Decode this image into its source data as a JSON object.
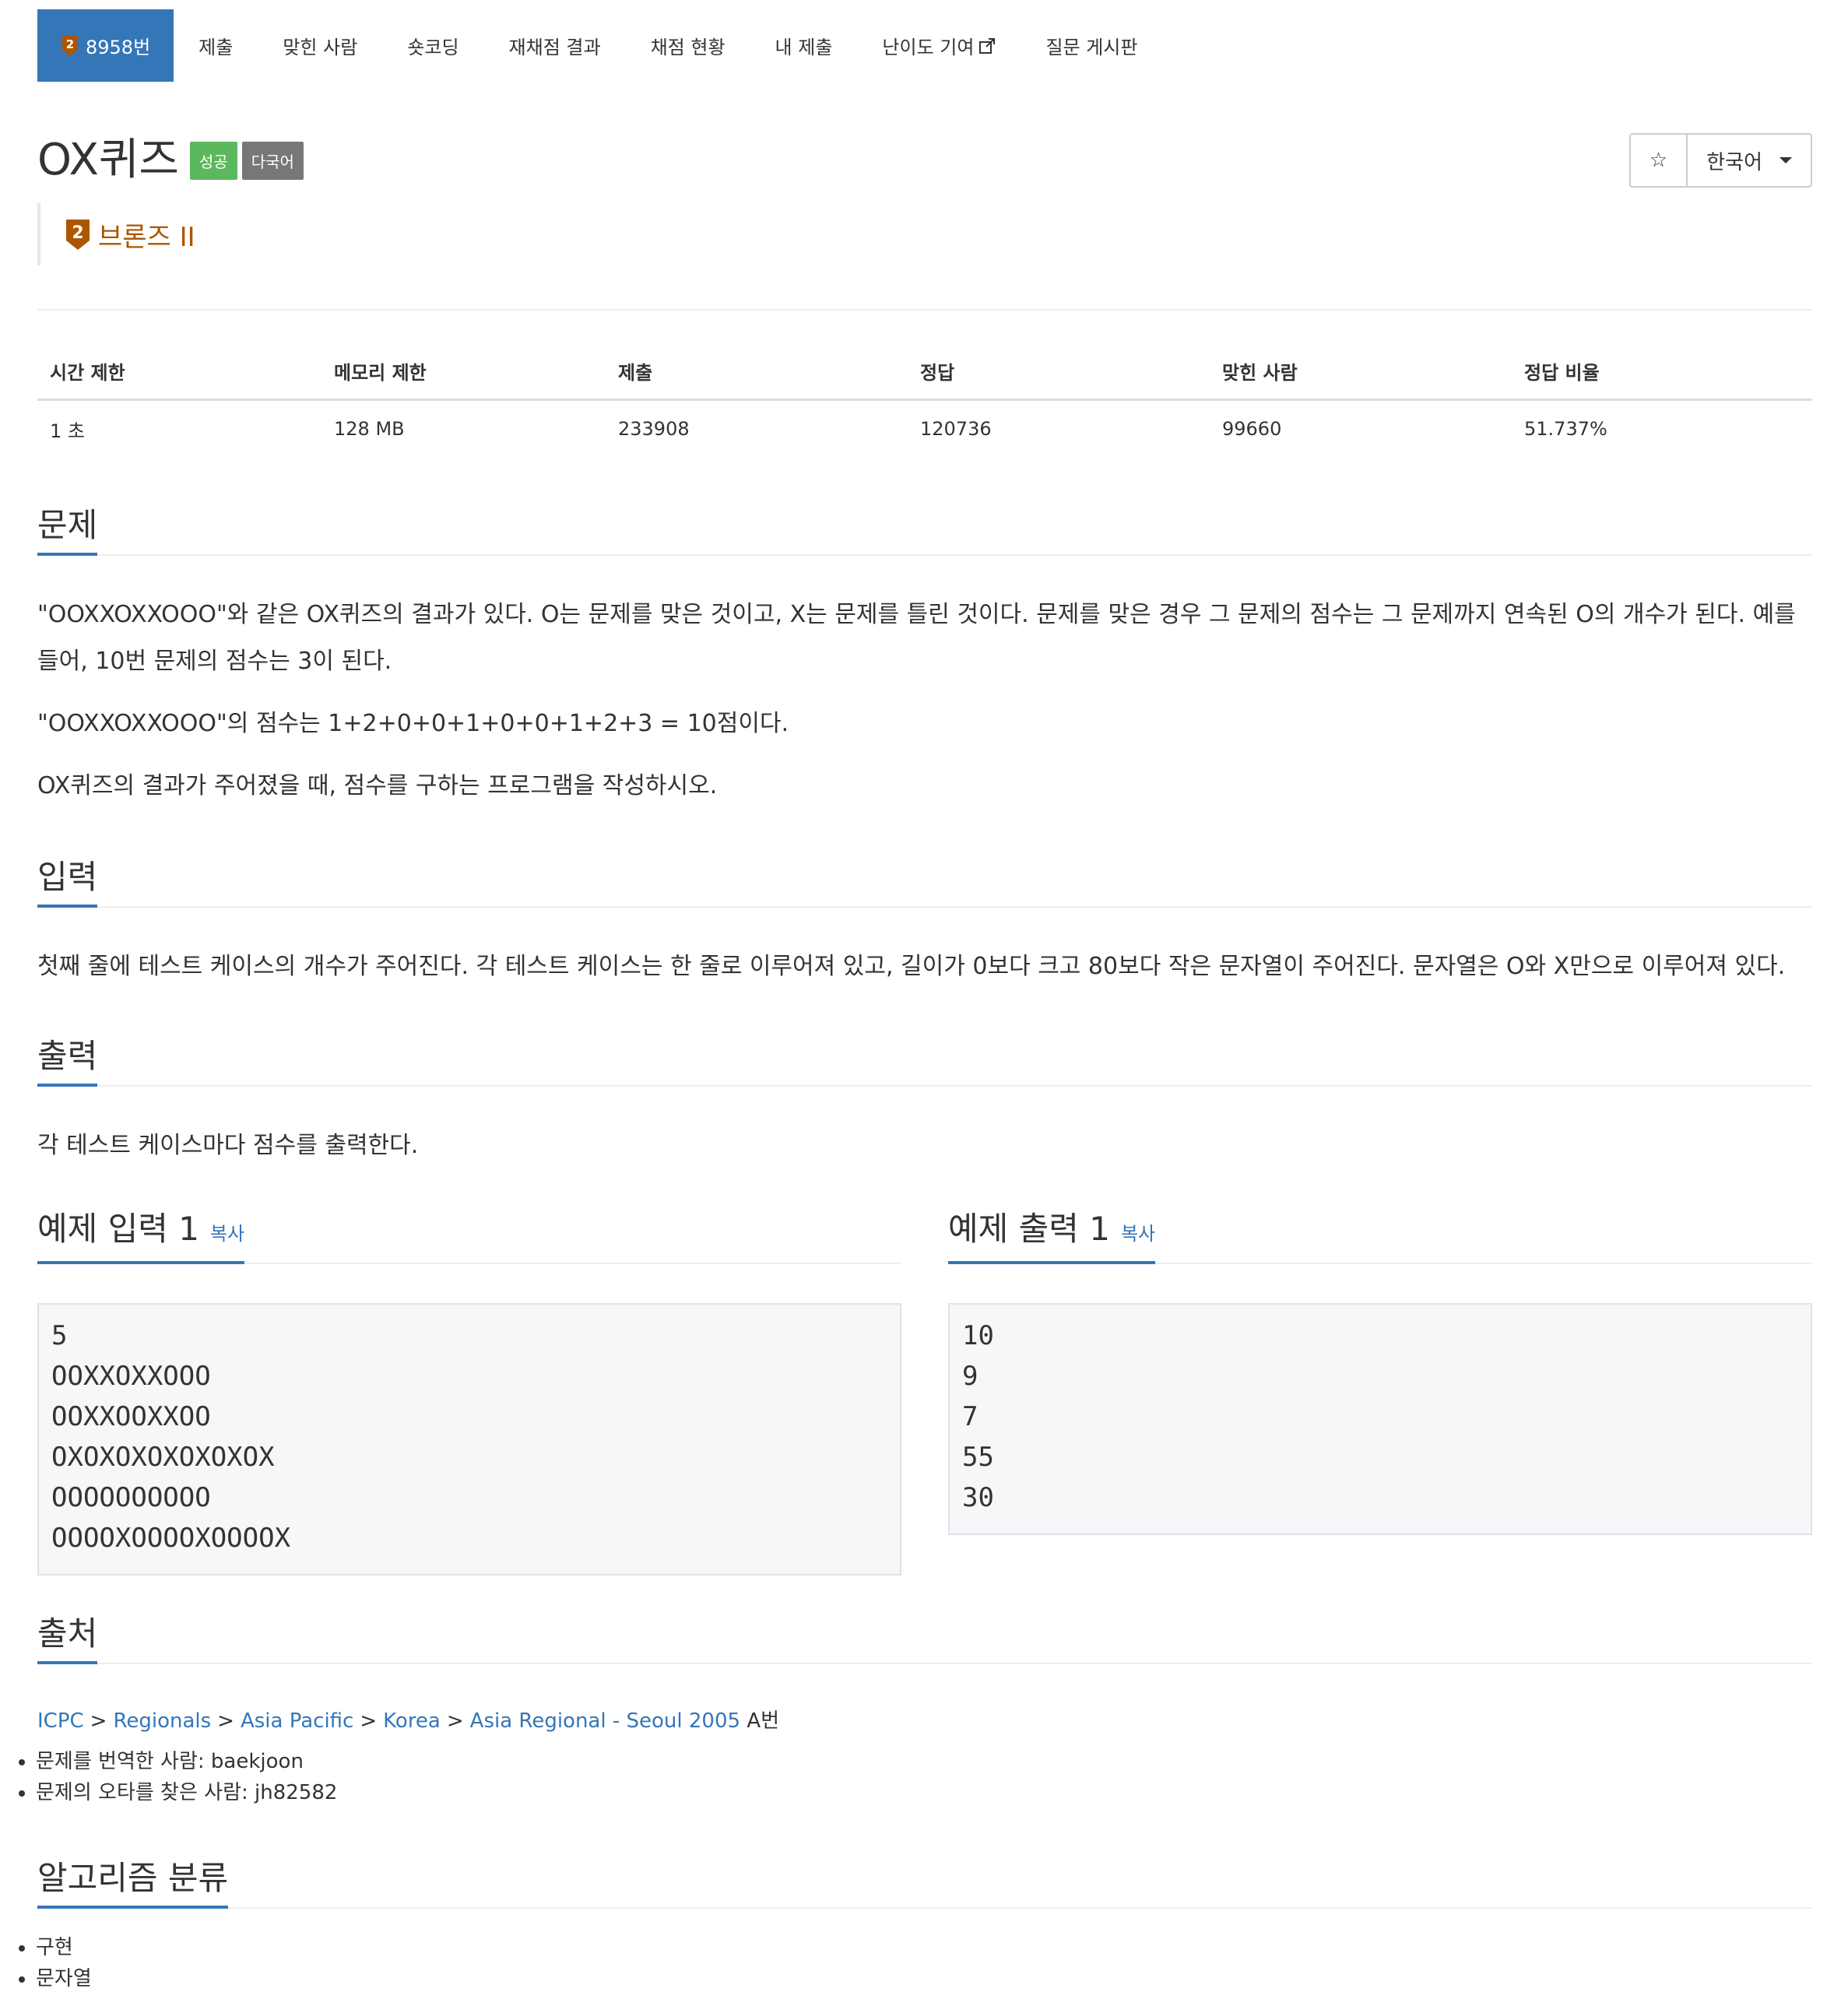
{
  "nav": {
    "problem_number": "8958번",
    "items": [
      "제출",
      "맞힌 사람",
      "숏코딩",
      "재채점 결과",
      "채점 현황",
      "내 제출",
      "난이도 기여",
      "질문 게시판"
    ]
  },
  "tier_badge_number": "2",
  "colors": {
    "accent": "#3476b8",
    "bronze": "#ad5600",
    "success": "#5cb85c",
    "gray_label": "#777777"
  },
  "problem": {
    "title": "OX퀴즈",
    "label_success": "성공",
    "label_multilang": "다국어",
    "tier": "브론즈 II",
    "language": "한국어",
    "star_icon": "☆"
  },
  "info": {
    "headers": [
      "시간 제한",
      "메모리 제한",
      "제출",
      "정답",
      "맞힌 사람",
      "정답 비율"
    ],
    "values": [
      "1 초",
      "128 MB",
      "233908",
      "120736",
      "99660",
      "51.737%"
    ]
  },
  "sections": {
    "problem_title": "문제",
    "problem_text": [
      "\"OOXXOXXOOO\"와 같은 OX퀴즈의 결과가 있다. O는 문제를 맞은 것이고, X는 문제를 틀린 것이다. 문제를 맞은 경우 그 문제의 점수는 그 문제까지 연속된 O의 개수가 된다. 예를 들어, 10번 문제의 점수는 3이 된다.",
      "\"OOXXOXXOOO\"의 점수는 1+2+0+0+1+0+0+1+2+3 = 10점이다.",
      "OX퀴즈의 결과가 주어졌을 때, 점수를 구하는 프로그램을 작성하시오."
    ],
    "input_title": "입력",
    "input_text": "첫째 줄에 테스트 케이스의 개수가 주어진다. 각 테스트 케이스는 한 줄로 이루어져 있고, 길이가 0보다 크고 80보다 작은 문자열이 주어진다. 문자열은 O와 X만으로 이루어져 있다.",
    "output_title": "출력",
    "output_text": "각 테스트 케이스마다 점수를 출력한다.",
    "sample_input_title": "예제 입력 1",
    "sample_output_title": "예제 출력 1",
    "copy_label": "복사",
    "sample_input": "5\nOOXXOXXOOO\nOOXXOOXXOO\nOXOXOXOXOXOXOX\nOOOOOOOOOO\nOOOOXOOOOXOOOOX",
    "sample_output": "10\n9\n7\n55\n30",
    "source_title": "출처",
    "source_links": [
      "ICPC",
      "Regionals",
      "Asia Pacific",
      "Korea",
      "Asia Regional - Seoul 2005"
    ],
    "source_suffix": "A번",
    "source_sep": ">",
    "credits": [
      "문제를 번역한 사람: baekjoon",
      "문제의 오타를 찾은 사람: jh82582"
    ],
    "algo_title": "알고리즘 분류",
    "algo_tags": [
      "구현",
      "문자열"
    ]
  }
}
